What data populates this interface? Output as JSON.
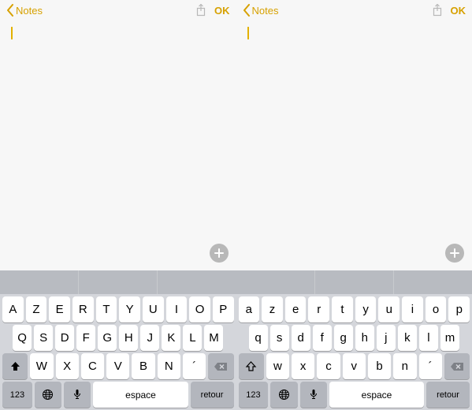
{
  "panes": [
    {
      "navbar": {
        "back": "Notes",
        "ok": "OK"
      },
      "keyboard": {
        "row1": [
          "A",
          "Z",
          "E",
          "R",
          "T",
          "Y",
          "U",
          "I",
          "O",
          "P"
        ],
        "row2": [
          "Q",
          "S",
          "D",
          "F",
          "G",
          "H",
          "J",
          "K",
          "L",
          "M"
        ],
        "row3_letters": [
          "W",
          "X",
          "C",
          "V",
          "B",
          "N",
          "´"
        ],
        "row4": {
          "num": "123",
          "space": "espace",
          "return": "retour"
        }
      }
    },
    {
      "navbar": {
        "back": "Notes",
        "ok": "OK"
      },
      "keyboard": {
        "row1": [
          "a",
          "z",
          "e",
          "r",
          "t",
          "y",
          "u",
          "i",
          "o",
          "p"
        ],
        "row2": [
          "q",
          "s",
          "d",
          "f",
          "g",
          "h",
          "j",
          "k",
          "l",
          "m"
        ],
        "row3_letters": [
          "w",
          "x",
          "c",
          "v",
          "b",
          "n",
          "´"
        ],
        "row4": {
          "num": "123",
          "space": "espace",
          "return": "retour"
        }
      }
    }
  ]
}
